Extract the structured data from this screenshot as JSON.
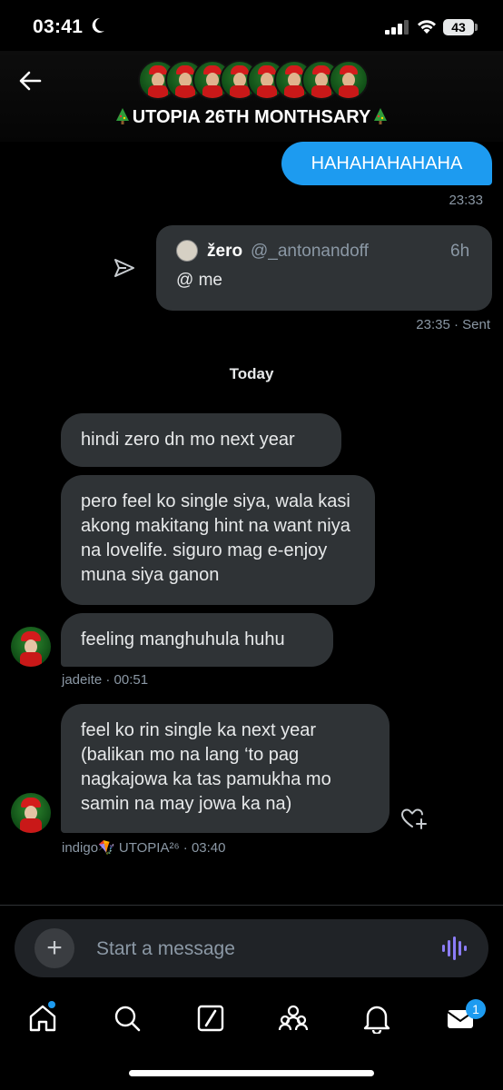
{
  "status_bar": {
    "time": "03:41",
    "battery": "43"
  },
  "header": {
    "title": "UTOPIA 26TH MONTHSARY",
    "avatar_count": 8
  },
  "messages": {
    "sent_text": "HAHAHAHAHAHA",
    "sent_time": "23:33",
    "quote": {
      "name": "žero",
      "handle": "@_antonandoff",
      "age": "6h",
      "text": "@ me"
    },
    "quote_status": "23:35 · Sent",
    "day_label": "Today",
    "received_1": "hindi zero dn mo next year",
    "received_2": "pero feel ko single siya, wala kasi akong makitang hint na want niya na lovelife. siguro mag e-enjoy muna siya ganon",
    "received_3": "feeling manghuhula huhu",
    "received_3_meta": "jadeite · 00:51",
    "received_4": "feel ko rin single ka next year (balikan mo na lang ‘to pag nagkajowa ka tas pamukha mo samin na may jowa ka na)",
    "received_4_meta": "indigo🪁 UTOPIA²⁶ · 03:40"
  },
  "composer": {
    "placeholder": "Start a message"
  },
  "tabbar": {
    "mail_badge": "1"
  },
  "colors": {
    "accent": "#1d9bf0",
    "bubble": "#2f3336",
    "background": "#000000"
  }
}
